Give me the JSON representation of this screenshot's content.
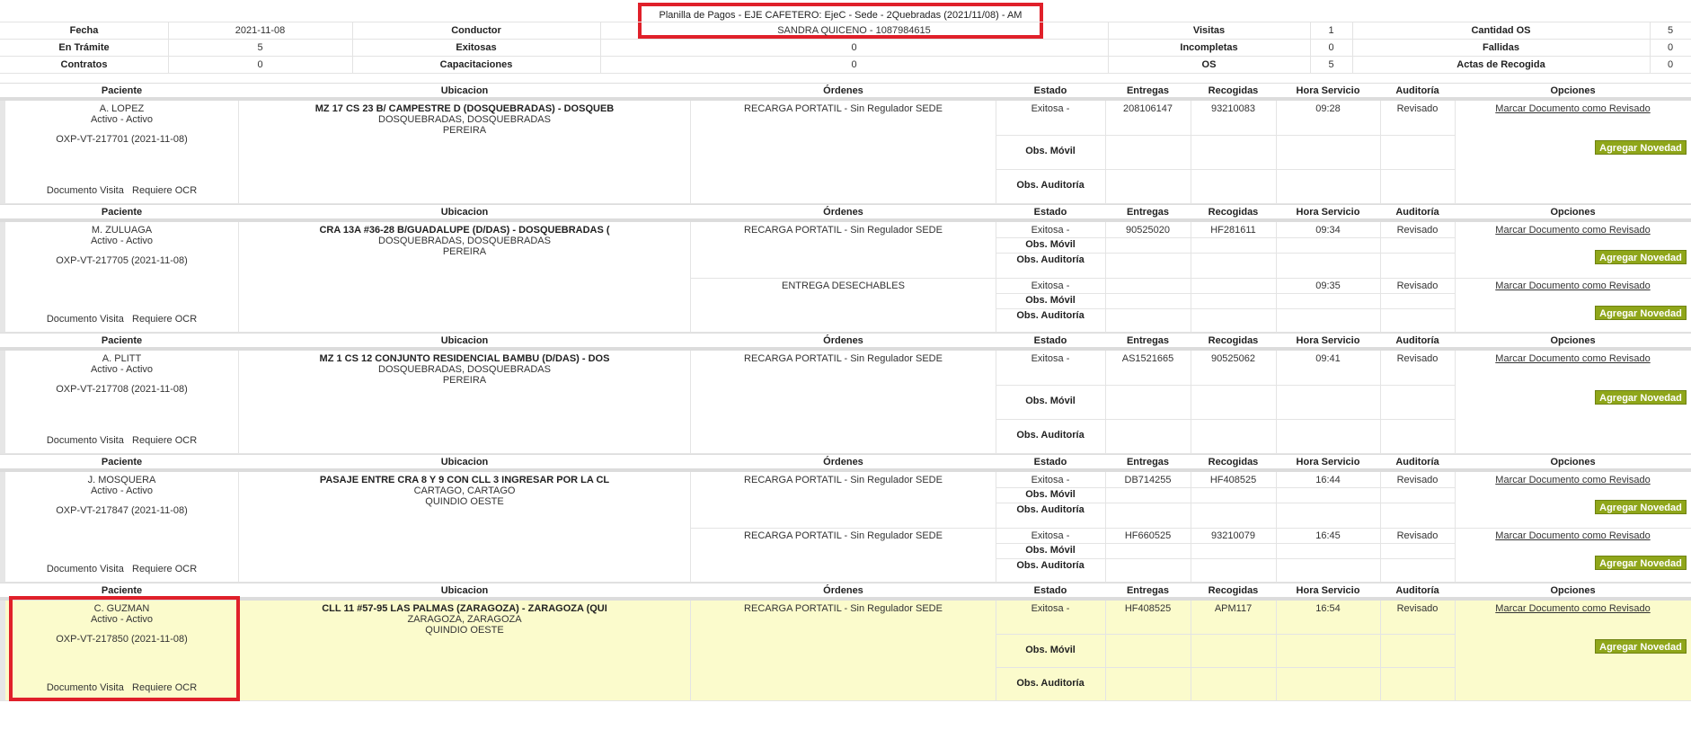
{
  "summary": {
    "title": "Planilla de Pagos - EJE CAFETERO: EjeC - Sede - 2Quebradas (2021/11/08) - AM",
    "rows": [
      [
        {
          "l": "Fecha"
        },
        {
          "v": "2021-11-08"
        },
        {
          "l": "Conductor"
        },
        {
          "v": "SANDRA QUICENO - 1087984615"
        },
        {
          "l": "Visitas"
        },
        {
          "v": "1"
        },
        {
          "l": "Cantidad OS"
        },
        {
          "v": "5"
        }
      ],
      [
        {
          "l": "En Trámite"
        },
        {
          "v": "5"
        },
        {
          "l": "Exitosas"
        },
        {
          "v": "0"
        },
        {
          "l": "Incompletas"
        },
        {
          "v": "0"
        },
        {
          "l": "Fallidas"
        },
        {
          "v": "0"
        }
      ],
      [
        {
          "l": "Contratos"
        },
        {
          "v": "0"
        },
        {
          "l": "Capacitaciones"
        },
        {
          "v": "0"
        },
        {
          "l": "OS"
        },
        {
          "v": "5"
        },
        {
          "l": "Actas de Recogida"
        },
        {
          "v": "0"
        }
      ]
    ]
  },
  "headers": {
    "paciente": "Paciente",
    "ubicacion": "Ubicacion",
    "ordenes": "Órdenes",
    "estado": "Estado",
    "entregas": "Entregas",
    "recogidas": "Recogidas",
    "hora": "Hora Servicio",
    "auditoria": "Auditoría",
    "opciones": "Opciones"
  },
  "labels": {
    "documento_visita": "Documento Visita",
    "requiere_ocr": "Requiere OCR",
    "obs_movil": "Obs. Móvil",
    "obs_auditoria": "Obs. Auditoría",
    "marcar": "Marcar Documento como Revisado",
    "agregar": "Agregar Novedad"
  },
  "colors": {
    "accent_button": "#8fa61a",
    "highlight_row": "#fbfbcc",
    "annotation_red": "#e0202a"
  },
  "visits": [
    {
      "name": "A. LOPEZ",
      "status": "Activo - Activo",
      "code": "OXP-VT-217701 (2021-11-08)",
      "address": "MZ 17 CS 23 B/ CAMPESTRE D (DOSQUEBRADAS) - DOSQUEB",
      "city": "DOSQUEBRADAS, DOSQUEBRADAS",
      "region": "PEREIRA",
      "highlight": false,
      "orders": [
        {
          "orden": "RECARGA PORTATIL - Sin Regulador SEDE",
          "estado": "Exitosa -",
          "entregas": "208106147",
          "recogidas": "93210083",
          "hora": "09:28",
          "auditoria": "Revisado"
        }
      ]
    },
    {
      "name": "M. ZULUAGA",
      "status": "Activo - Activo",
      "code": "OXP-VT-217705 (2021-11-08)",
      "address": "CRA 13A #36-28 B/GUADALUPE (D/DAS) - DOSQUEBRADAS (",
      "city": "DOSQUEBRADAS, DOSQUEBRADAS",
      "region": "PEREIRA",
      "highlight": false,
      "orders": [
        {
          "orden": "RECARGA PORTATIL - Sin Regulador SEDE",
          "estado": "Exitosa -",
          "entregas": "90525020",
          "recogidas": "HF281611",
          "hora": "09:34",
          "auditoria": "Revisado"
        },
        {
          "orden": "ENTREGA DESECHABLES",
          "estado": "Exitosa -",
          "entregas": "",
          "recogidas": "",
          "hora": "09:35",
          "auditoria": "Revisado"
        }
      ]
    },
    {
      "name": "A. PLITT",
      "status": "Activo - Activo",
      "code": "OXP-VT-217708 (2021-11-08)",
      "address": "MZ 1 CS 12 CONJUNTO RESIDENCIAL BAMBU (D/DAS) - DOS",
      "city": "DOSQUEBRADAS, DOSQUEBRADAS",
      "region": "PEREIRA",
      "highlight": false,
      "orders": [
        {
          "orden": "RECARGA PORTATIL - Sin Regulador SEDE",
          "estado": "Exitosa -",
          "entregas": "AS1521665",
          "recogidas": "90525062",
          "hora": "09:41",
          "auditoria": "Revisado"
        }
      ]
    },
    {
      "name": "J. MOSQUERA",
      "status": "Activo - Activo",
      "code": "OXP-VT-217847 (2021-11-08)",
      "address": "PASAJE ENTRE CRA 8 Y 9 CON CLL 3 INGRESAR POR LA CL",
      "city": "CARTAGO, CARTAGO",
      "region": "QUINDIO OESTE",
      "highlight": false,
      "orders": [
        {
          "orden": "RECARGA PORTATIL - Sin Regulador SEDE",
          "estado": "Exitosa -",
          "entregas": "DB714255",
          "recogidas": "HF408525",
          "hora": "16:44",
          "auditoria": "Revisado"
        },
        {
          "orden": "RECARGA PORTATIL - Sin Regulador SEDE",
          "estado": "Exitosa -",
          "entregas": "HF660525",
          "recogidas": "93210079",
          "hora": "16:45",
          "auditoria": "Revisado"
        }
      ]
    },
    {
      "name": "C. GUZMAN",
      "status": "Activo - Activo",
      "code": "OXP-VT-217850 (2021-11-08)",
      "address": "CLL 11 #57-95 LAS PALMAS (ZARAGOZA) - ZARAGOZA (QUI",
      "city": "ZARAGOZA, ZARAGOZA",
      "region": "QUINDIO OESTE",
      "highlight": true,
      "orders": [
        {
          "orden": "RECARGA PORTATIL - Sin Regulador SEDE",
          "estado": "Exitosa -",
          "entregas": "HF408525",
          "recogidas": "APM117",
          "hora": "16:54",
          "auditoria": "Revisado"
        }
      ]
    }
  ]
}
